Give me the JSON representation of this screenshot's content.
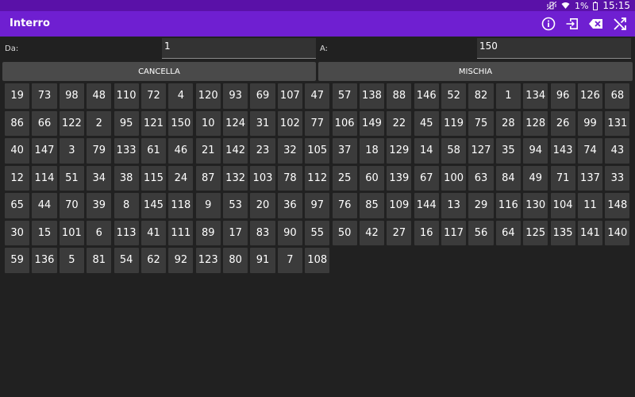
{
  "status": {
    "battery": "1%",
    "time": "15:15"
  },
  "app": {
    "title": "Interro"
  },
  "icons": {
    "info": "info-icon",
    "exit": "exit-icon",
    "backspace": "backspace-icon",
    "shuffle": "shuffle-icon"
  },
  "form": {
    "from_label": "Da:",
    "from_value": "1",
    "to_label": "A:",
    "to_value": "150"
  },
  "buttons": {
    "clear": "CANCELLA",
    "shuffle": "MISCHIA"
  },
  "numbers": [
    19,
    73,
    98,
    48,
    110,
    72,
    4,
    120,
    93,
    69,
    107,
    47,
    57,
    138,
    88,
    146,
    52,
    82,
    1,
    134,
    96,
    126,
    68,
    86,
    66,
    122,
    2,
    95,
    121,
    150,
    10,
    124,
    31,
    102,
    77,
    106,
    149,
    22,
    45,
    119,
    75,
    28,
    128,
    26,
    99,
    131,
    40,
    147,
    3,
    79,
    133,
    61,
    46,
    21,
    142,
    23,
    32,
    105,
    37,
    18,
    129,
    14,
    58,
    127,
    35,
    94,
    143,
    74,
    43,
    12,
    114,
    51,
    34,
    38,
    115,
    24,
    87,
    132,
    103,
    78,
    112,
    25,
    60,
    139,
    67,
    100,
    63,
    84,
    49,
    71,
    137,
    33,
    65,
    44,
    70,
    39,
    8,
    145,
    118,
    9,
    53,
    20,
    36,
    97,
    76,
    85,
    109,
    144,
    13,
    29,
    116,
    130,
    104,
    11,
    148,
    30,
    15,
    101,
    6,
    113,
    41,
    111,
    89,
    17,
    83,
    90,
    55,
    50,
    42,
    27,
    16,
    117,
    56,
    64,
    125,
    135,
    141,
    140,
    59,
    136,
    5,
    81,
    54,
    62,
    92,
    123,
    80,
    91,
    7,
    108
  ],
  "colors": {
    "appbar": "#6f1fd1",
    "statusbar": "#5a11a8",
    "background": "#212121",
    "cell": "#3b3b3b"
  }
}
